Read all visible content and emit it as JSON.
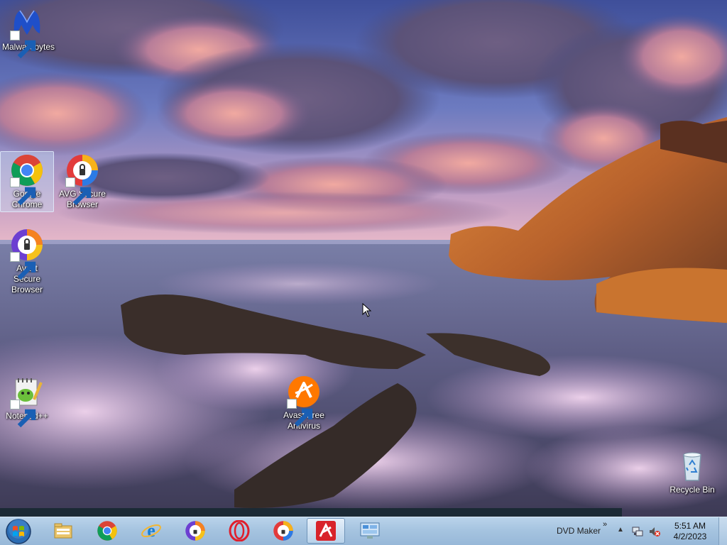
{
  "desktop": {
    "icons": [
      {
        "label": "Malwarebytes",
        "icon": "malwarebytes-icon"
      },
      {
        "label": "Google Chrome",
        "icon": "chrome-icon",
        "selected": true
      },
      {
        "label": "AVG Secure Browser",
        "icon": "avg-secure-browser-icon"
      },
      {
        "label": "Avast Secure Browser",
        "icon": "avast-secure-browser-icon"
      },
      {
        "label": "Notepad++",
        "icon": "notepad-plus-plus-icon"
      },
      {
        "label": "Avast Free Antivirus",
        "icon": "avast-antivirus-icon"
      },
      {
        "label": "Recycle Bin",
        "icon": "recycle-bin-icon"
      }
    ]
  },
  "taskbar": {
    "start_icon": "windows-start-orb-icon",
    "pinned": [
      {
        "icon": "file-explorer-icon"
      },
      {
        "icon": "chrome-icon"
      },
      {
        "icon": "internet-explorer-icon"
      },
      {
        "icon": "avast-secure-browser-icon"
      },
      {
        "icon": "opera-icon"
      },
      {
        "icon": "avg-secure-browser-icon"
      },
      {
        "icon": "avira-icon",
        "active": true
      },
      {
        "icon": "control-panel-icon"
      }
    ],
    "toolbar_label": "DVD Maker",
    "toolbar_chevron": "»",
    "tray_arrow": "▲",
    "tray_icons": [
      "network-icon",
      "volume-muted-icon"
    ],
    "clock": {
      "time": "5:51 AM",
      "date": "4/2/2023"
    }
  },
  "colors": {
    "taskbar": "#a6c4e0",
    "selection": "#c8dcf5"
  }
}
